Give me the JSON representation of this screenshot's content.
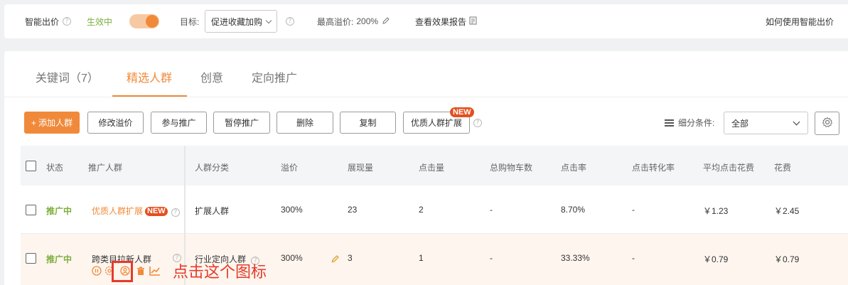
{
  "topbar": {
    "smart_bid_label": "智能出价",
    "status": "生效中",
    "goal_label": "目标:",
    "goal_value": "促进收藏加购",
    "max_premium_label": "最高溢价:",
    "max_premium_value": "200%",
    "report_link": "查看效果报告",
    "help_link": "如何使用智能出价"
  },
  "tabs": [
    {
      "label": "关键词（7）"
    },
    {
      "label": "精选人群"
    },
    {
      "label": "创意"
    },
    {
      "label": "定向推广"
    }
  ],
  "toolbar": {
    "add": "+ 添加人群",
    "modify": "修改溢价",
    "join": "参与推广",
    "pause": "暂停推广",
    "delete": "删除",
    "copy": "复制",
    "expand": "优质人群扩展",
    "new_badge": "NEW",
    "filter_label": "细分条件:",
    "filter_value": "全部"
  },
  "table": {
    "headers": [
      "状态",
      "推广人群",
      "人群分类",
      "溢价",
      "展现量",
      "点击量",
      "总购物车数",
      "点击率",
      "点击转化率",
      "平均点击花费",
      "花费"
    ],
    "rows": [
      {
        "status": "推广中",
        "audience": "优质人群扩展",
        "badge": "NEW",
        "category": "扩展人群",
        "premium": "300%",
        "impressions": "23",
        "clicks": "2",
        "cart": "-",
        "ctr": "8.70%",
        "cvr": "-",
        "cpc": "￥1.23",
        "cost": "￥2.45"
      },
      {
        "status": "推广中",
        "audience": "跨类目拉新人群",
        "category": "行业定向人群",
        "premium": "300%",
        "impressions": "3",
        "clicks": "1",
        "cart": "-",
        "ctr": "33.33%",
        "cvr": "-",
        "cpc": "￥0.79",
        "cost": "￥0.79"
      }
    ]
  },
  "annotation": "点击这个图标",
  "colors": {
    "accent": "#f08a3a",
    "status_green": "#7cae3c",
    "highlight_red": "#e63a2a"
  }
}
